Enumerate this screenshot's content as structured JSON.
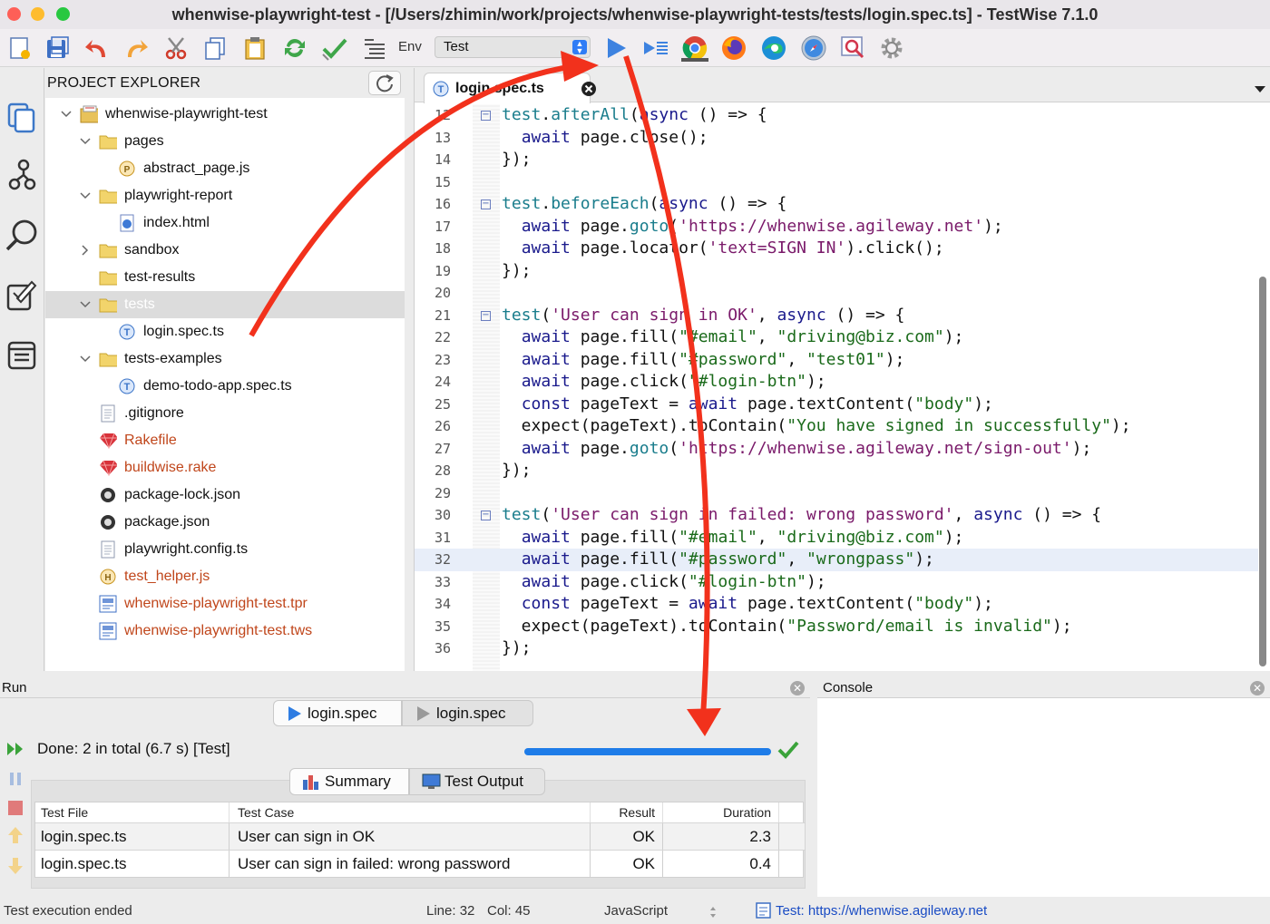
{
  "window": {
    "title": "whenwise-playwright-test - [/Users/zhimin/work/projects/whenwise-playwright-tests/tests/login.spec.ts] - TestWise 7.1.0"
  },
  "toolbar": {
    "env_label": "Env",
    "env_value": "Test"
  },
  "explorer": {
    "title": "PROJECT EXPLORER",
    "items": [
      {
        "label": "whenwise-playwright-test",
        "icon": "project-folder-icon",
        "chev": "down",
        "red": false
      },
      {
        "label": "pages",
        "icon": "folder-icon",
        "chev": "down",
        "red": false
      },
      {
        "label": "abstract_page.js",
        "icon": "page-file-icon",
        "chev": "",
        "red": false
      },
      {
        "label": "playwright-report",
        "icon": "folder-icon",
        "chev": "down",
        "red": false
      },
      {
        "label": "index.html",
        "icon": "html-file-icon",
        "chev": "",
        "red": false
      },
      {
        "label": "sandbox",
        "icon": "folder-icon",
        "chev": "right",
        "red": false
      },
      {
        "label": "test-results",
        "icon": "folder-icon",
        "chev": "",
        "red": false
      },
      {
        "label": "tests",
        "icon": "folder-icon",
        "chev": "down",
        "red": false,
        "selected": true
      },
      {
        "label": "login.spec.ts",
        "icon": "test-file-icon",
        "chev": "",
        "red": false
      },
      {
        "label": "tests-examples",
        "icon": "folder-icon",
        "chev": "down",
        "red": false
      },
      {
        "label": "demo-todo-app.spec.ts",
        "icon": "test-file-icon",
        "chev": "",
        "red": false
      },
      {
        "label": ".gitignore",
        "icon": "text-file-icon",
        "chev": "",
        "red": false
      },
      {
        "label": "Rakefile",
        "icon": "ruby-gem-icon",
        "chev": "",
        "red": true
      },
      {
        "label": "buildwise.rake",
        "icon": "ruby-gem-icon",
        "chev": "",
        "red": true
      },
      {
        "label": "package-lock.json",
        "icon": "json-file-icon",
        "chev": "",
        "red": false
      },
      {
        "label": "package.json",
        "icon": "json-file-icon",
        "chev": "",
        "red": false
      },
      {
        "label": "playwright.config.ts",
        "icon": "text-file-icon",
        "chev": "",
        "red": false
      },
      {
        "label": "test_helper.js",
        "icon": "helper-file-icon",
        "chev": "",
        "red": true
      },
      {
        "label": "whenwise-playwright-test.tpr",
        "icon": "project-file-icon",
        "chev": "",
        "red": true
      },
      {
        "label": "whenwise-playwright-test.tws",
        "icon": "project-file-icon",
        "chev": "",
        "red": true
      }
    ]
  },
  "editor": {
    "tab_label": "login.spec.ts",
    "lines": [
      {
        "n": "12",
        "fold": true,
        "parts": [
          [
            "fn",
            "test"
          ],
          [
            "p",
            "."
          ],
          [
            "fn",
            "afterAll"
          ],
          [
            "p",
            "("
          ],
          [
            "kw",
            "async"
          ],
          [
            "p",
            " () => {"
          ]
        ]
      },
      {
        "n": "13",
        "parts": [
          [
            "p",
            "  "
          ],
          [
            "kw",
            "await"
          ],
          [
            "p",
            " page.close();"
          ]
        ]
      },
      {
        "n": "14",
        "parts": [
          [
            "p",
            "});"
          ]
        ]
      },
      {
        "n": "15",
        "parts": []
      },
      {
        "n": "16",
        "fold": true,
        "parts": [
          [
            "fn",
            "test"
          ],
          [
            "p",
            "."
          ],
          [
            "fn",
            "beforeEach"
          ],
          [
            "p",
            "("
          ],
          [
            "kw",
            "async"
          ],
          [
            "p",
            " () => {"
          ]
        ]
      },
      {
        "n": "17",
        "parts": [
          [
            "p",
            "  "
          ],
          [
            "kw",
            "await"
          ],
          [
            "p",
            " page."
          ],
          [
            "fn",
            "goto"
          ],
          [
            "p",
            "("
          ],
          [
            "str",
            "'https://whenwise.agileway.net'"
          ],
          [
            "p",
            ");"
          ]
        ]
      },
      {
        "n": "18",
        "parts": [
          [
            "p",
            "  "
          ],
          [
            "kw",
            "await"
          ],
          [
            "p",
            " page.locator("
          ],
          [
            "str",
            "'text=SIGN IN'"
          ],
          [
            "p",
            ").click();"
          ]
        ]
      },
      {
        "n": "19",
        "parts": [
          [
            "p",
            "});"
          ]
        ]
      },
      {
        "n": "20",
        "parts": []
      },
      {
        "n": "21",
        "fold": true,
        "parts": [
          [
            "fn",
            "test"
          ],
          [
            "p",
            "("
          ],
          [
            "str",
            "'User can sign in OK'"
          ],
          [
            "p",
            ", "
          ],
          [
            "kw",
            "async"
          ],
          [
            "p",
            " () => {"
          ]
        ]
      },
      {
        "n": "22",
        "parts": [
          [
            "p",
            "  "
          ],
          [
            "kw",
            "await"
          ],
          [
            "p",
            " page.fill("
          ],
          [
            "dq",
            "\"#email\""
          ],
          [
            "p",
            ", "
          ],
          [
            "dq",
            "\"driving@biz.com\""
          ],
          [
            "p",
            ");"
          ]
        ]
      },
      {
        "n": "23",
        "parts": [
          [
            "p",
            "  "
          ],
          [
            "kw",
            "await"
          ],
          [
            "p",
            " page.fill("
          ],
          [
            "dq",
            "\"#password\""
          ],
          [
            "p",
            ", "
          ],
          [
            "dq",
            "\"test01\""
          ],
          [
            "p",
            ");"
          ]
        ]
      },
      {
        "n": "24",
        "parts": [
          [
            "p",
            "  "
          ],
          [
            "kw",
            "await"
          ],
          [
            "p",
            " page.click("
          ],
          [
            "dq",
            "\"#login-btn\""
          ],
          [
            "p",
            ");"
          ]
        ]
      },
      {
        "n": "25",
        "parts": [
          [
            "p",
            "  "
          ],
          [
            "kw",
            "const"
          ],
          [
            "p",
            " pageText = "
          ],
          [
            "kw",
            "await"
          ],
          [
            "p",
            " page.textContent("
          ],
          [
            "dq",
            "\"body\""
          ],
          [
            "p",
            ");"
          ]
        ]
      },
      {
        "n": "26",
        "parts": [
          [
            "p",
            "  expect(pageText).toContain("
          ],
          [
            "dq",
            "\"You have signed in successfully\""
          ],
          [
            "p",
            ");"
          ]
        ]
      },
      {
        "n": "27",
        "parts": [
          [
            "p",
            "  "
          ],
          [
            "kw",
            "await"
          ],
          [
            "p",
            " page."
          ],
          [
            "fn",
            "goto"
          ],
          [
            "p",
            "("
          ],
          [
            "str",
            "'https://whenwise.agileway.net/sign-out'"
          ],
          [
            "p",
            ");"
          ]
        ]
      },
      {
        "n": "28",
        "parts": [
          [
            "p",
            "});"
          ]
        ]
      },
      {
        "n": "29",
        "parts": []
      },
      {
        "n": "30",
        "fold": true,
        "parts": [
          [
            "fn",
            "test"
          ],
          [
            "p",
            "("
          ],
          [
            "str",
            "'User can sign in failed: wrong password'"
          ],
          [
            "p",
            ", "
          ],
          [
            "kw",
            "async"
          ],
          [
            "p",
            " () => {"
          ]
        ]
      },
      {
        "n": "31",
        "parts": [
          [
            "p",
            "  "
          ],
          [
            "kw",
            "await"
          ],
          [
            "p",
            " page.fill("
          ],
          [
            "dq",
            "\"#email\""
          ],
          [
            "p",
            ", "
          ],
          [
            "dq",
            "\"driving@biz.com\""
          ],
          [
            "p",
            ");"
          ]
        ]
      },
      {
        "n": "32",
        "hl": true,
        "parts": [
          [
            "p",
            "  "
          ],
          [
            "kw",
            "await"
          ],
          [
            "p",
            " page.fill("
          ],
          [
            "dq",
            "\"#password\""
          ],
          [
            "p",
            ", "
          ],
          [
            "dq",
            "\"wrongpass\""
          ],
          [
            "p",
            ");"
          ]
        ]
      },
      {
        "n": "33",
        "parts": [
          [
            "p",
            "  "
          ],
          [
            "kw",
            "await"
          ],
          [
            "p",
            " page.click("
          ],
          [
            "dq",
            "\"#login-btn\""
          ],
          [
            "p",
            ");"
          ]
        ]
      },
      {
        "n": "34",
        "parts": [
          [
            "p",
            "  "
          ],
          [
            "kw",
            "const"
          ],
          [
            "p",
            " pageText = "
          ],
          [
            "kw",
            "await"
          ],
          [
            "p",
            " page.textContent("
          ],
          [
            "dq",
            "\"body\""
          ],
          [
            "p",
            ");"
          ]
        ]
      },
      {
        "n": "35",
        "parts": [
          [
            "p",
            "  expect(pageText).toContain("
          ],
          [
            "dq",
            "\"Password/email is invalid\""
          ],
          [
            "p",
            ");"
          ]
        ]
      },
      {
        "n": "36",
        "parts": [
          [
            "p",
            "});"
          ]
        ]
      }
    ]
  },
  "run": {
    "title": "Run",
    "tab1": "login.spec",
    "tab2": "login.spec",
    "status": "Done: 2 in total (6.7 s) [Test]",
    "progress": 1.0,
    "summary_tab": "Summary",
    "output_tab": "Test Output",
    "columns": [
      "Test File",
      "Test Case",
      "Result",
      "Duration"
    ],
    "rows": [
      [
        "login.spec.ts",
        "User can sign in OK",
        "OK",
        "2.3"
      ],
      [
        "login.spec.ts",
        "User can sign in failed: wrong password",
        "OK",
        "0.4"
      ]
    ]
  },
  "console": {
    "title": "Console"
  },
  "status": {
    "message": "Test execution ended",
    "line": "Line: 32",
    "col": "Col: 45",
    "language": "JavaScript",
    "env": "Test: https://whenwise.agileway.net"
  },
  "colors": {
    "annotation_arrow": "#f2311c",
    "accent": "#1e7ce8",
    "link": "#1a4cc4"
  }
}
